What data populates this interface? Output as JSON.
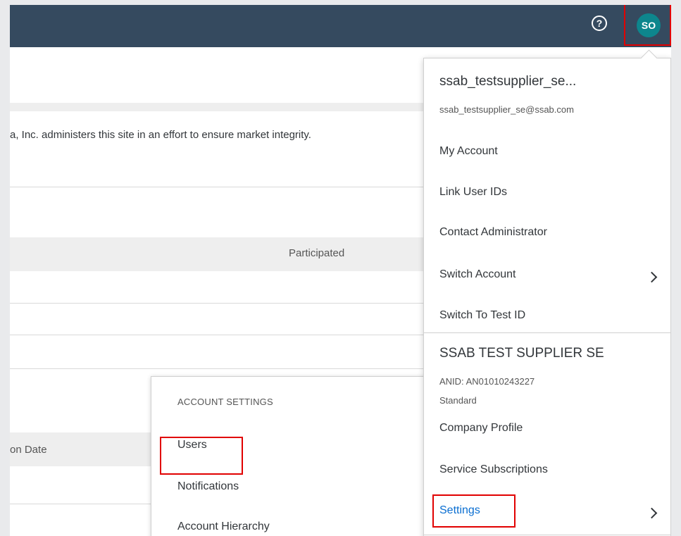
{
  "topbar": {
    "help_icon": "question-circle-icon",
    "help_glyph": "?",
    "avatar_initials": "SO"
  },
  "background": {
    "notice_text": "a, Inc. administers this site in an effort to ensure market integrity.",
    "table_header_participated": "Participated",
    "table_header_date_partial": "on Date"
  },
  "account_settings": {
    "title": "ACCOUNT SETTINGS",
    "items": [
      "Users",
      "Notifications",
      "Account Hierarchy"
    ]
  },
  "user_menu": {
    "user_name": "ssab_testsupplier_se...",
    "user_email": "ssab_testsupplier_se@ssab.com",
    "items": [
      "My Account",
      "Link User IDs",
      "Contact Administrator",
      "Switch Account",
      "Switch To Test ID"
    ],
    "company_name": "SSAB TEST SUPPLIER SE",
    "anid": "ANID: AN01010243227",
    "plan": "Standard",
    "company_items": [
      "Company Profile",
      "Service Subscriptions",
      "Settings"
    ]
  },
  "colors": {
    "topbar": "#354a5f",
    "avatar": "#0d868d",
    "highlight": "#e10000",
    "link": "#0a6ed1"
  }
}
